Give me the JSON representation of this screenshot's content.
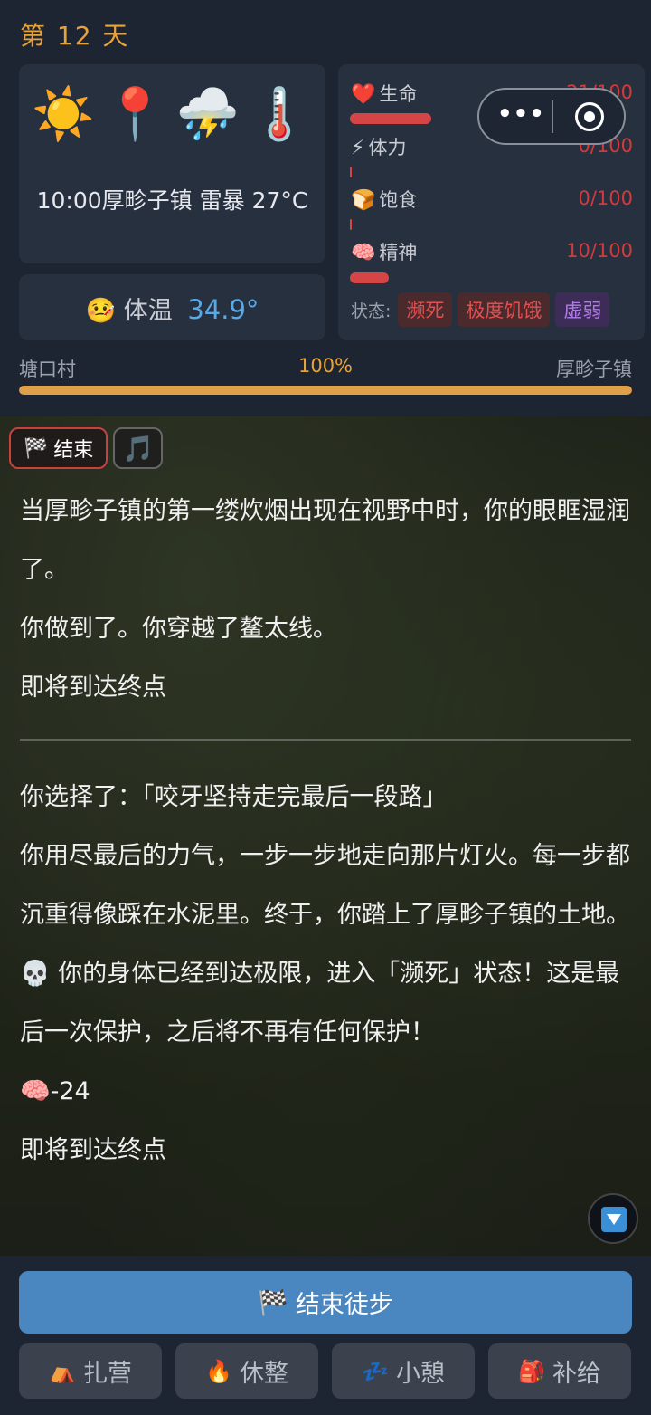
{
  "header": {
    "day": "第 12 天"
  },
  "weather": {
    "icons": [
      "sun-icon",
      "location-pin-icon",
      "thunderstorm-icon",
      "thermometer-icon"
    ],
    "time_location": "10:00厚畛子镇",
    "condition": "雷暴",
    "temperature": "27°C"
  },
  "body_temp": {
    "label": "体温",
    "value": "34.9°"
  },
  "stats": {
    "health": {
      "label": "生命",
      "value": "21/100",
      "fraction": 0.21
    },
    "stamina": {
      "label": "体力",
      "value": "0/100",
      "fraction": 0
    },
    "satiety": {
      "label": "饱食",
      "value": "0/100",
      "fraction": 0
    },
    "spirit": {
      "label": "精神",
      "value": "10/100",
      "fraction": 0.1
    },
    "status_label": "状态:",
    "statuses": [
      "濒死",
      "极度饥饿",
      "虚弱"
    ]
  },
  "route": {
    "from": "塘口村",
    "percent": "100%",
    "progress": 1.0,
    "to": "厚畛子镇"
  },
  "story": {
    "end_chip": "结束",
    "paragraphs_a": [
      "当厚畛子镇的第一缕炊烟出现在视野中时，你的眼眶湿润了。",
      "你做到了。你穿越了鳌太线。",
      "即将到达终点"
    ],
    "paragraphs_b": [
      "你选择了：「咬牙坚持走完最后一段路」",
      "你用尽最后的力气，一步一步地走向那片灯火。每一步都沉重得像踩在水泥里。终于，你踏上了厚畛子镇的土地。",
      "💀 你的身体已经到达极限，进入「濒死」状态！这是最后一次保护，之后将不再有任何保护！",
      "🧠-24",
      "即将到达终点"
    ]
  },
  "actions": {
    "main": "结束徒步",
    "camp": "扎营",
    "rest": "休整",
    "nap": "小憩",
    "supply": "补给"
  }
}
